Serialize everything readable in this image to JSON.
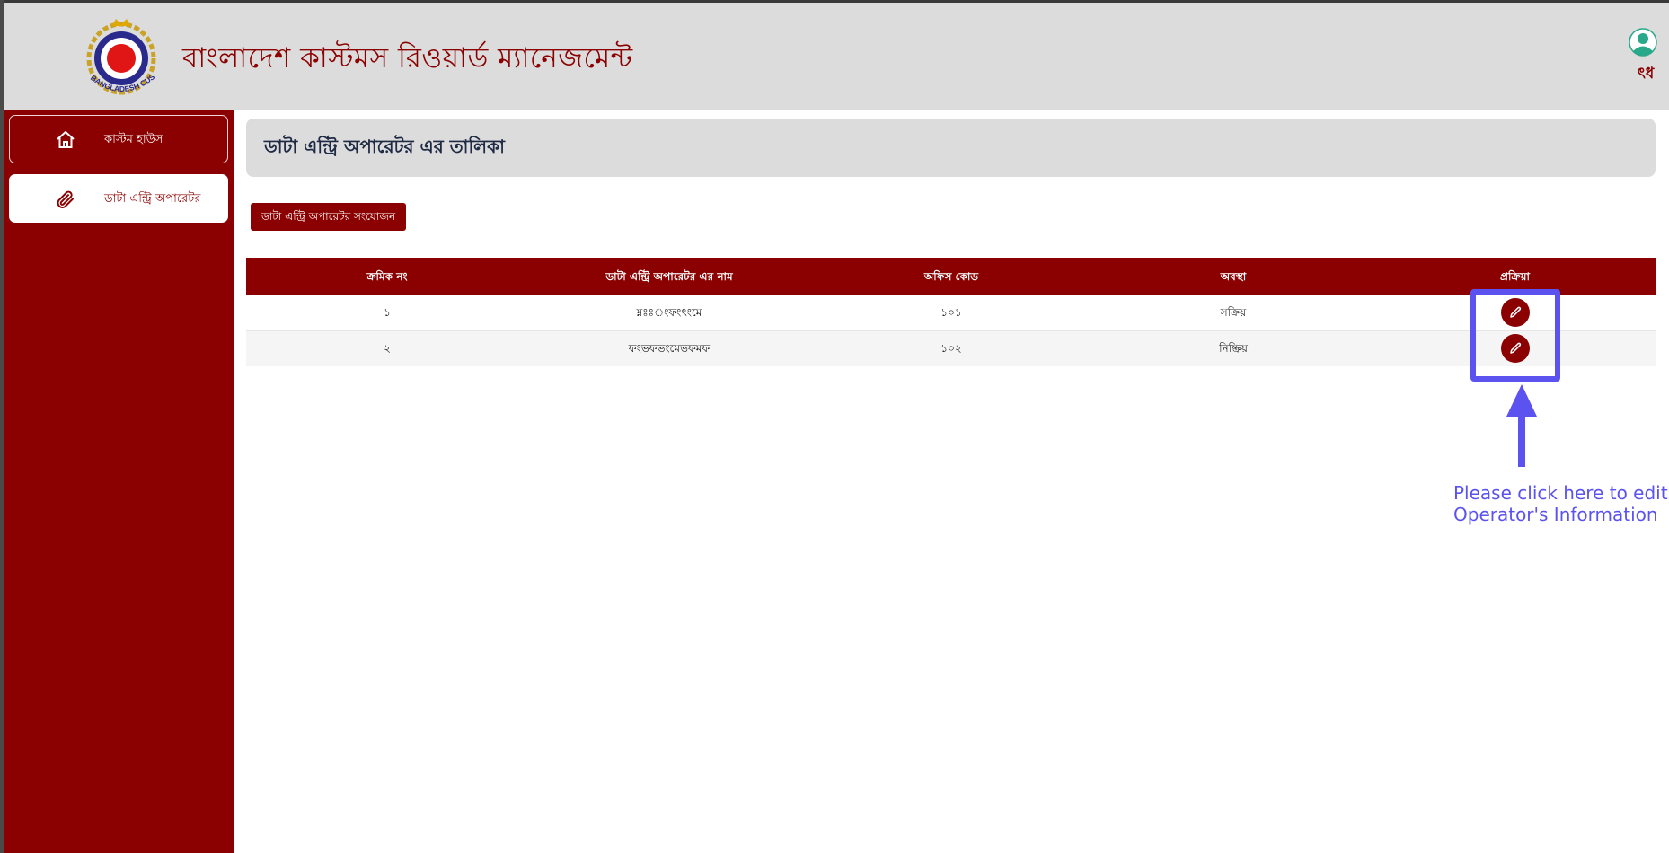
{
  "header": {
    "title": "বাংলাদেশ কাস্টমস রিওয়ার্ড ম্যানেজমেন্ট",
    "logo_text": "BANGLADESH CUSTOMS & VAT",
    "user_name": "ৎধ"
  },
  "sidebar": {
    "items": [
      {
        "label": "কাস্টম হাউস",
        "icon": "home-icon"
      },
      {
        "label": "ডাটা এন্ট্রি অপারেটর",
        "icon": "paperclip-icon"
      }
    ]
  },
  "main": {
    "title": "ডাটা এন্ট্রি অপারেটর এর তালিকা",
    "add_button": "ডাটা এন্ট্রি অপারেটর সংযোজন",
    "table": {
      "headers": [
        "ক্রমিক নং",
        "ডাটা এন্ট্রি অপারেটর এর নাম",
        "অফিস কোড",
        "অবস্থা",
        "প্রক্রিয়া"
      ],
      "rows": [
        {
          "serial": "১",
          "name": "ম্নঃঃংফংৎংমে",
          "office_code": "১০১",
          "status": "সক্রিয়"
        },
        {
          "serial": "২",
          "name": "ফংভফভংমেভফমফ",
          "office_code": "১০২",
          "status": "নিষ্ক্রিয়"
        }
      ]
    }
  },
  "annotation": {
    "line1": "Please click here to edit",
    "line2": "Operator's Information"
  },
  "colors": {
    "brand": "#8b0000",
    "header_bg": "#dcdcdc",
    "annotation": "#5b52f0"
  }
}
